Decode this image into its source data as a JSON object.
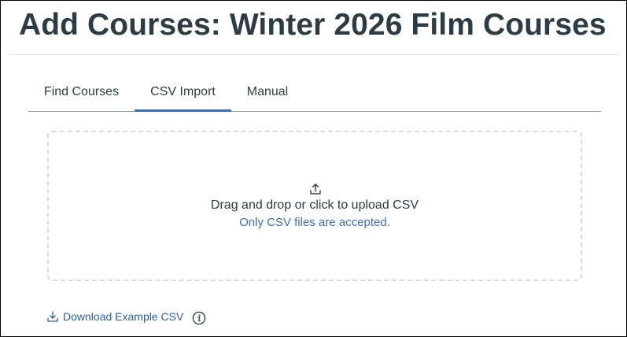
{
  "page": {
    "title": "Add Courses: Winter 2026 Film Courses"
  },
  "tabs": [
    {
      "label": "Find Courses",
      "active": false
    },
    {
      "label": "CSV Import",
      "active": true
    },
    {
      "label": "Manual",
      "active": false
    }
  ],
  "dropzone": {
    "icon": "upload-icon",
    "primary_text": "Drag and drop or click to upload CSV",
    "hint_text": "Only CSV files are accepted."
  },
  "download": {
    "icon": "download-icon",
    "label": "Download Example CSV",
    "info_icon": "info-icon"
  },
  "colors": {
    "text": "#2d3b45",
    "accent": "#3e6fa3",
    "link": "#2f5f92",
    "dashed_border": "#d7dbde"
  }
}
